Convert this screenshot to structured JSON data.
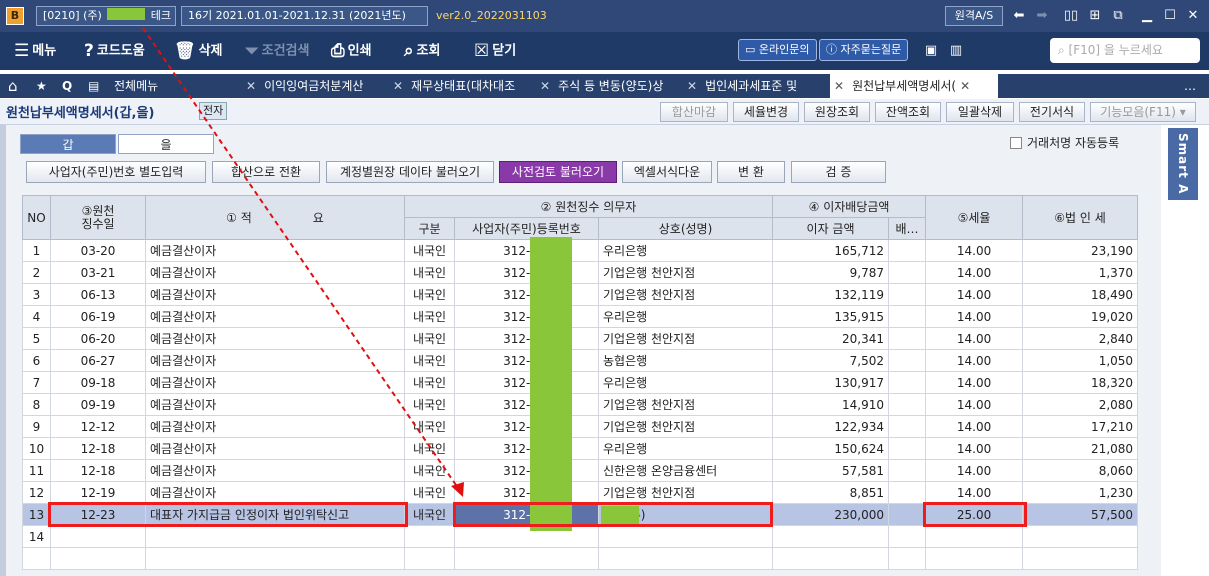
{
  "titlebar": {
    "company_code": "[0210] (주)",
    "company_suffix": "테크",
    "period": "16기 2021.01.01-2021.12.31 (2021년도)",
    "version": "ver2.0_2022031103",
    "remote_label": "원격A/S",
    "app_letter": "B"
  },
  "toolbar": {
    "menu": "메뉴",
    "code_help": "코드도움",
    "delete": "삭제",
    "cond_search": "조건검색",
    "print": "인쇄",
    "query": "조회",
    "close": "닫기",
    "online": "온라인문의",
    "faq": "자주묻는질문",
    "search_placeholder": "[F10] 을 누르세요"
  },
  "tabs": {
    "all_menu": "전체메뉴",
    "items": [
      "이익잉여금처분계산",
      "재무상태표(대차대조",
      "주식 등 변동(양도)상",
      "법인세과세표준 및",
      "원천납부세액명세서("
    ]
  },
  "header": {
    "title": "원천납부세액명세서(갑,을)",
    "jeonja": "전자",
    "buttons": [
      "합산마감",
      "세율변경",
      "원장조회",
      "잔액조회",
      "일괄삭제",
      "전기서식",
      "기능모음(F11)"
    ]
  },
  "subtabs": [
    "갑",
    "을"
  ],
  "auto_register": "거래처명 자동등록",
  "actions": [
    "사업자(주민)번호 별도입력",
    "합산으로 전환",
    "계정별원장 데이타 불러오기",
    "사전검토 불러오기",
    "엑셀서식다운",
    "변 환",
    "검 증"
  ],
  "smart": "Smart A",
  "grid": {
    "head": {
      "no": "NO",
      "date": "③원천\n징수일",
      "summary": "① 적                요",
      "payer": "② 원천징수 의무자",
      "interest": "④ 이자배당금액",
      "rate": "⑤세율",
      "tax": "⑥법 인 세",
      "kind": "구분",
      "bizno": "사업자(주민)등록번호",
      "name": "상호(성명)",
      "amount": "이자 금액",
      "div": "배…"
    },
    "rows": [
      [
        "1",
        "03-20",
        "예금결산이자",
        "내국인",
        "312-85-",
        "우리은행",
        "165,712",
        "",
        "14.00",
        "23,190"
      ],
      [
        "2",
        "03-21",
        "예금결산이자",
        "내국인",
        "312-85-",
        "기업은행 천안지점",
        "9,787",
        "",
        "14.00",
        "1,370"
      ],
      [
        "3",
        "06-13",
        "예금결산이자",
        "내국인",
        "312-85-",
        "기업은행 천안지점",
        "132,119",
        "",
        "14.00",
        "18,490"
      ],
      [
        "4",
        "06-19",
        "예금결산이자",
        "내국인",
        "312-85-",
        "우리은행",
        "135,915",
        "",
        "14.00",
        "19,020"
      ],
      [
        "5",
        "06-20",
        "예금결산이자",
        "내국인",
        "312-85-",
        "기업은행 천안지점",
        "20,341",
        "",
        "14.00",
        "2,840"
      ],
      [
        "6",
        "06-27",
        "예금결산이자",
        "내국인",
        "312-85-",
        "농협은행",
        "7,502",
        "",
        "14.00",
        "1,050"
      ],
      [
        "7",
        "09-18",
        "예금결산이자",
        "내국인",
        "312-85-",
        "우리은행",
        "130,917",
        "",
        "14.00",
        "18,320"
      ],
      [
        "8",
        "09-19",
        "예금결산이자",
        "내국인",
        "312-85-",
        "기업은행 천안지점",
        "14,910",
        "",
        "14.00",
        "2,080"
      ],
      [
        "9",
        "12-12",
        "예금결산이자",
        "내국인",
        "312-85-",
        "기업은행 천안지점",
        "122,934",
        "",
        "14.00",
        "17,210"
      ],
      [
        "10",
        "12-18",
        "예금결산이자",
        "내국인",
        "312-85-",
        "우리은행",
        "150,624",
        "",
        "14.00",
        "21,080"
      ],
      [
        "11",
        "12-18",
        "예금결산이자",
        "내국인",
        "312-85-",
        "신한은행 온양금융센터",
        "57,581",
        "",
        "14.00",
        "8,060"
      ],
      [
        "12",
        "12-19",
        "예금결산이자",
        "내국인",
        "312-85-",
        "기업은행 천안지점",
        "8,851",
        "",
        "14.00",
        "1,230"
      ],
      [
        "13",
        "12-23",
        "대표자 가지급금 인정이자 법인위탁신고",
        "내국인",
        "312-81-",
        "테크(주)",
        "230,000",
        "",
        "25.00",
        "57,500"
      ],
      [
        "14",
        "",
        "",
        "",
        "",
        "",
        "",
        "",
        "",
        ""
      ],
      [
        "",
        "",
        "",
        "",
        "",
        "",
        "",
        "",
        "",
        ""
      ]
    ]
  }
}
